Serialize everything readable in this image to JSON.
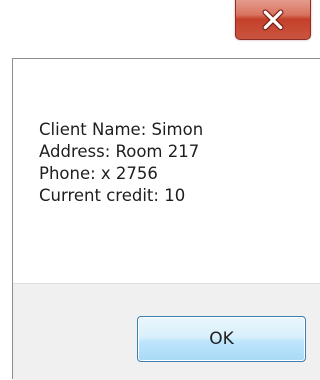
{
  "window": {
    "close_icon": "close-x-icon",
    "close_button_color": "#c9553f"
  },
  "message": {
    "lines": [
      "Client Name: Simon",
      "Address: Room 217",
      "Phone: x 2756",
      "Current credit: 10"
    ]
  },
  "buttons": {
    "ok_label": "OK"
  },
  "colors": {
    "footer_background": "#f0f0f0",
    "ok_button_border": "#3c7fb1"
  }
}
